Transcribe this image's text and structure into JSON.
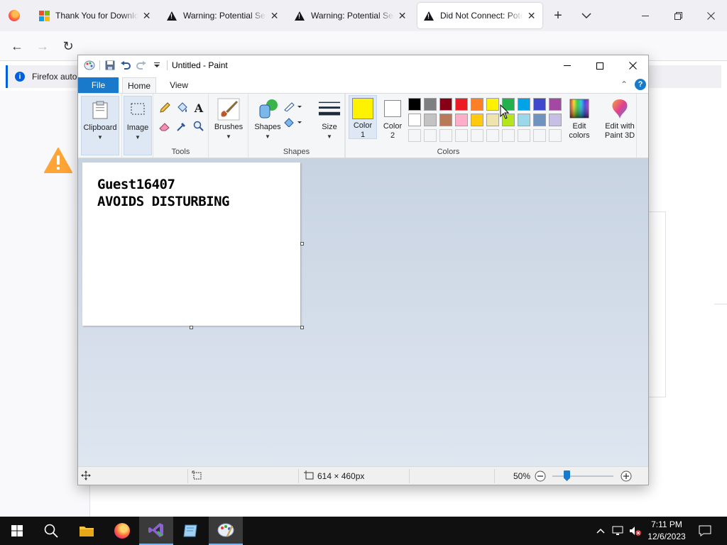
{
  "browser": {
    "tabs": [
      {
        "title": "Thank You for Downloading",
        "icon": "microsoft-logo",
        "active": false
      },
      {
        "title": "Warning: Potential Security Risk Ahead",
        "icon": "warning-icon",
        "active": false
      },
      {
        "title": "Warning: Potential Security Risk Ahead",
        "icon": "warning-icon",
        "active": false
      },
      {
        "title": "Did Not Connect: Potential Security Issue",
        "icon": "warning-icon",
        "active": true
      }
    ],
    "new_tab": "+",
    "notification": "Firefox auto"
  },
  "paint": {
    "title": "Untitled - Paint",
    "tabs": {
      "file": "File",
      "home": "Home",
      "view": "View"
    },
    "help": "?",
    "ribbon": {
      "clipboard": "Clipboard",
      "image": "Image",
      "tools_group": "Tools",
      "brushes": "Brushes",
      "shapes": "Shapes",
      "shapes_group": "Shapes",
      "size": "Size",
      "color1_line1": "Color",
      "color1_line2": "1",
      "color2_line1": "Color",
      "color2_line2": "2",
      "colors_group": "Colors",
      "edit_colors_line1": "Edit",
      "edit_colors_line2": "colors",
      "paint3d_line1": "Edit with",
      "paint3d_line2": "Paint 3D"
    },
    "color1": "#fff200",
    "color2": "#ffffff",
    "palette_row1": [
      "#000000",
      "#7f7f7f",
      "#880015",
      "#ed1c24",
      "#ff7f27",
      "#fff200",
      "#22b14c",
      "#00a2e8",
      "#3f48cc",
      "#a349a4"
    ],
    "palette_row2": [
      "#ffffff",
      "#c3c3c3",
      "#b97a57",
      "#ffaec9",
      "#ffc90e",
      "#efe4b0",
      "#b5e61d",
      "#99d9ea",
      "#7092be",
      "#c8bfe7"
    ],
    "canvas_lines": [
      "Guest16407",
      "AVOIDS DISTURBING"
    ],
    "status": {
      "dimensions": "614 × 460px",
      "zoom": "50%"
    }
  },
  "taskbar": {
    "time": "7:11 PM",
    "date": "12/6/2023"
  }
}
